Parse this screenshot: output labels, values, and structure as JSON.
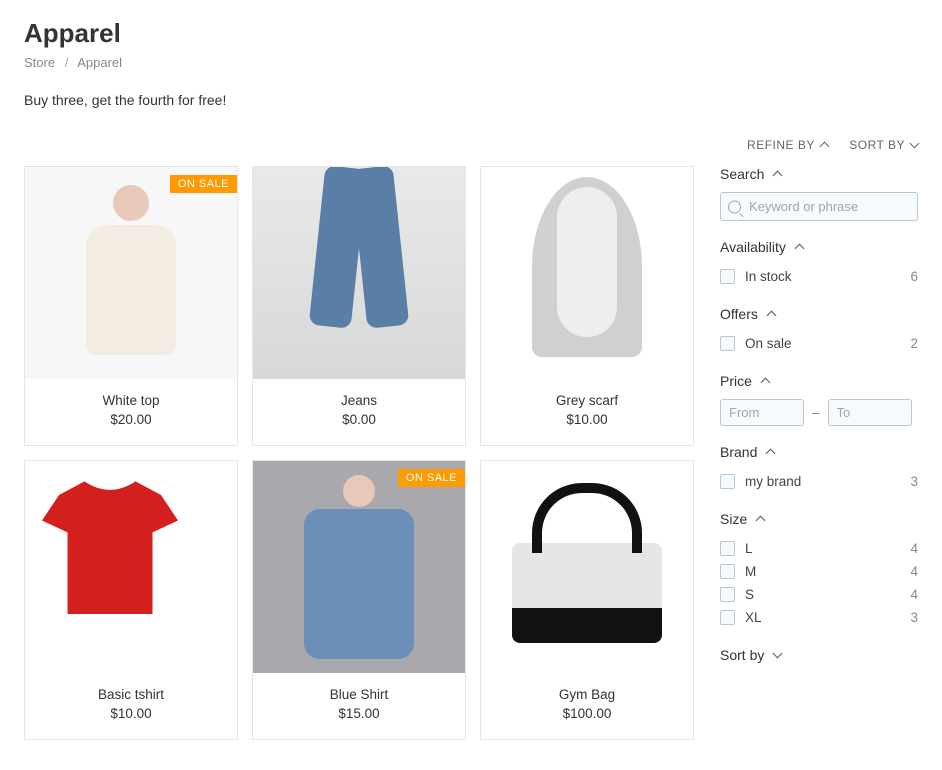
{
  "title": "Apparel",
  "breadcrumb": {
    "store": "Store",
    "current": "Apparel"
  },
  "promo": "Buy three, get the fourth for free!",
  "toolbar": {
    "refine": "REFINE BY",
    "sort": "SORT BY"
  },
  "products": [
    {
      "name": "White top",
      "price": "$20.00",
      "on_sale": true
    },
    {
      "name": "Jeans",
      "price": "$0.00",
      "on_sale": false
    },
    {
      "name": "Grey scarf",
      "price": "$10.00",
      "on_sale": false
    },
    {
      "name": "Basic tshirt",
      "price": "$10.00",
      "on_sale": false
    },
    {
      "name": "Blue Shirt",
      "price": "$15.00",
      "on_sale": true
    },
    {
      "name": "Gym Bag",
      "price": "$100.00",
      "on_sale": false
    }
  ],
  "badge_on_sale": "ON SALE",
  "filters": {
    "search": {
      "title": "Search",
      "placeholder": "Keyword or phrase"
    },
    "availability": {
      "title": "Availability",
      "options": [
        {
          "label": "In stock",
          "count": "6"
        }
      ]
    },
    "offers": {
      "title": "Offers",
      "options": [
        {
          "label": "On sale",
          "count": "2"
        }
      ]
    },
    "price": {
      "title": "Price",
      "from_placeholder": "From",
      "to_placeholder": "To"
    },
    "brand": {
      "title": "Brand",
      "options": [
        {
          "label": "my brand",
          "count": "3"
        }
      ]
    },
    "size": {
      "title": "Size",
      "options": [
        {
          "label": "L",
          "count": "4"
        },
        {
          "label": "M",
          "count": "4"
        },
        {
          "label": "S",
          "count": "4"
        },
        {
          "label": "XL",
          "count": "3"
        }
      ]
    },
    "sortby": {
      "title": "Sort by"
    }
  }
}
